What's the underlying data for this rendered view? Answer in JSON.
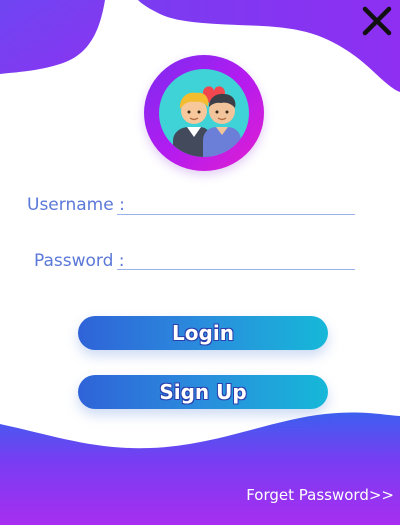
{
  "form": {
    "username_label": "Username :",
    "password_label": "Password :",
    "username_value": "",
    "password_value": ""
  },
  "buttons": {
    "login_label": "Login",
    "signup_label": "Sign Up"
  },
  "footer": {
    "forget_password_label": "Forget Password>>"
  },
  "icons": {
    "close": "close-icon",
    "avatar": "couple-avatar-icon"
  },
  "colors": {
    "blob_purple": "#7b3cf0",
    "blob_violet": "#9b2cf2",
    "label_blue": "#5b78d8",
    "button_start": "#2f63d8",
    "button_end": "#16b8d8"
  }
}
